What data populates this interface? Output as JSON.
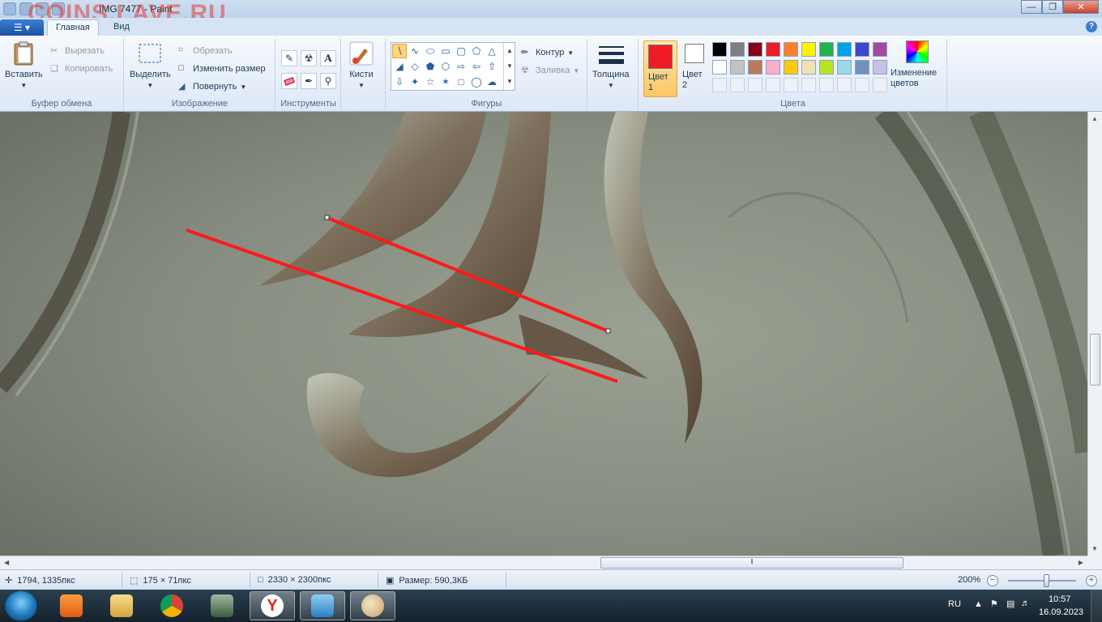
{
  "window": {
    "title": "IMG 7477 - Paint",
    "watermark": "COINS.LAVE.RU"
  },
  "tabs": [
    {
      "label": "Главная",
      "active": true
    },
    {
      "label": "Вид",
      "active": false
    }
  ],
  "help_label": "?",
  "ribbon": {
    "clipboard": {
      "label": "Буфер обмена",
      "paste": "Вставить",
      "cut": "Вырезать",
      "copy": "Копировать"
    },
    "image": {
      "label": "Изображение",
      "select": "Выделить",
      "crop": "Обрезать",
      "resize": "Изменить размер",
      "rotate": "Повернуть"
    },
    "tools": {
      "label": "Инструменты",
      "text_glyph": "A"
    },
    "brushes": {
      "label": "Кисти"
    },
    "shapes": {
      "label": "Фигуры",
      "outline": "Контур",
      "fill": "Заливка"
    },
    "size": {
      "label": "Толщина"
    },
    "colors": {
      "label": "Цвета",
      "color1": "Цвет 1",
      "color2": "Цвет 2",
      "edit_colors": "Изменение цветов",
      "color1_value": "#ed1c24",
      "color2_value": "#ffffff",
      "palette_row1": [
        "#000000",
        "#7f7f7f",
        "#880015",
        "#ed1c24",
        "#ff7f27",
        "#fff200",
        "#22b14c",
        "#00a2e8",
        "#3f48cc",
        "#a349a4"
      ],
      "palette_row2": [
        "#ffffff",
        "#c3c3c3",
        "#b97a57",
        "#ffaec9",
        "#ffc90e",
        "#efe4b0",
        "#b5e61d",
        "#99d9ea",
        "#7092be",
        "#c8bfe7"
      ]
    }
  },
  "canvas": {
    "annotation_color": "#ff1a1a"
  },
  "status": {
    "cursor_pos": "1794, 1335пкс",
    "selection_size": "175 × 71пкс",
    "image_size": "2330 × 2300пкс",
    "file_size": "Размер: 590,3КБ",
    "zoom": "200%"
  },
  "taskbar": {
    "language": "RU",
    "time": "10:57",
    "date": "16.09.2023"
  }
}
